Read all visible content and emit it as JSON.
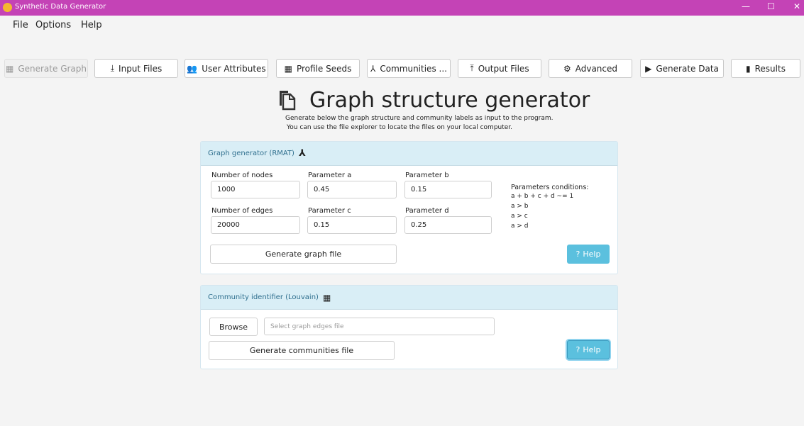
{
  "window": {
    "title": "Synthetic Data Generator",
    "minimize": "—",
    "maximize": "☐",
    "close": "✕",
    "accent": "#c443b6"
  },
  "menu": [
    "File",
    "Options",
    "Help"
  ],
  "tabs": [
    {
      "label": "Generate Graph",
      "icon": "▦",
      "icon_name": "graph-grid-icon",
      "state": "disabled"
    },
    {
      "label": "Input Files",
      "icon": "⤓",
      "icon_name": "download-icon"
    },
    {
      "label": "User Attributes",
      "icon": "👥",
      "icon_name": "users-icon"
    },
    {
      "label": "Profile Seeds",
      "icon": "▦",
      "icon_name": "grid-icon"
    },
    {
      "label": "Communities ...",
      "icon": "⅄",
      "icon_name": "network-icon"
    },
    {
      "label": "Output Files",
      "icon": "⤒",
      "icon_name": "upload-icon"
    },
    {
      "label": "Advanced",
      "icon": "⚙",
      "icon_name": "gear-icon"
    },
    {
      "label": "Generate Data",
      "icon": "▶",
      "icon_name": "play-icon"
    },
    {
      "label": "Results",
      "icon": "▮",
      "icon_name": "bar-chart-icon"
    }
  ],
  "header": {
    "title": "Graph structure generator",
    "line1": "Generate below the graph structure and community labels as input to the program.",
    "line2": "You can use the file explorer to locate the files on your local computer."
  },
  "graph_panel": {
    "title": "Graph generator (RMAT)",
    "fields": {
      "nodes_label": "Number of nodes",
      "nodes_value": "1000",
      "a_label": "Parameter a",
      "a_value": "0.45",
      "b_label": "Parameter b",
      "b_value": "0.15",
      "edges_label": "Number of edges",
      "edges_value": "20000",
      "c_label": "Parameter c",
      "c_value": "0.15",
      "d_label": "Parameter d",
      "d_value": "0.25"
    },
    "conditions": [
      "Parameters conditions:",
      "a + b + c + d ~= 1",
      "a > b",
      "a > c",
      "a > d"
    ],
    "generate_label": "Generate graph file",
    "help_label": "Help"
  },
  "community_panel": {
    "title": "Community identifier (Louvain)",
    "browse_label": "Browse",
    "file_placeholder": "Select graph edges file",
    "generate_label": "Generate communities file",
    "help_label": "Help"
  },
  "colors": {
    "help_button": "#5bc0de",
    "panel_header": "#d9eef6"
  }
}
